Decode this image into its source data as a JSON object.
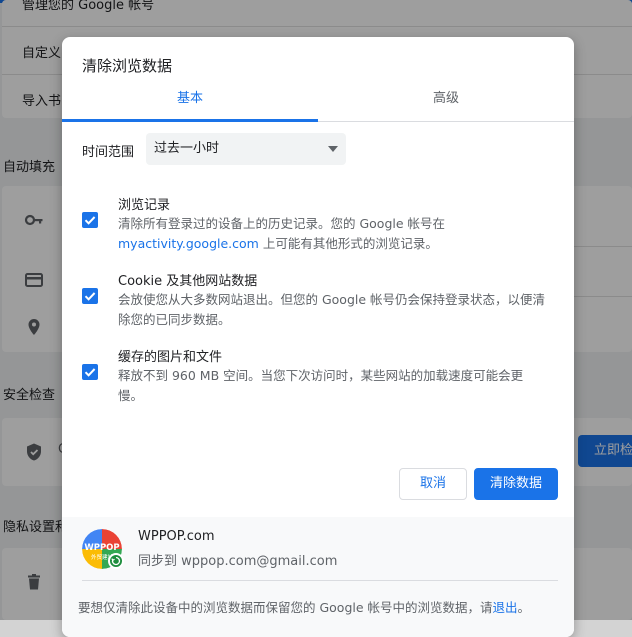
{
  "background": {
    "rows": {
      "manage_account": "管理您的 Google 帐号",
      "customize": "自定义",
      "import": "导入书"
    },
    "sections": {
      "autofill": "自动填充",
      "safety_check": "安全检查",
      "privacy": "隐私设置和"
    },
    "check_now_button": "立即检",
    "safety_text": "C"
  },
  "dialog": {
    "title": "清除浏览数据",
    "tabs": [
      {
        "label": "基本",
        "active": true
      },
      {
        "label": "高级",
        "active": false
      }
    ],
    "time_range": {
      "label": "时间范围",
      "selected": "过去一小时"
    },
    "options": [
      {
        "title": "浏览记录",
        "desc_before_link": "清除所有登录过的设备上的历史记录。您的 Google 帐号在",
        "link": "myactivity.google.com",
        "desc_after_link": " 上可能有其他形式的浏览记录。",
        "checked": true
      },
      {
        "title": "Cookie 及其他网站数据",
        "desc": "会放使您从大多数网站退出。但您的 Google 帐号仍会保持登录状态，以便清除您的已同步数据。",
        "checked": true
      },
      {
        "title": "缓存的图片和文件",
        "desc": "释放不到 960 MB 空间。当您下次访问时，某些网站的加载速度可能会更慢。",
        "checked": true
      }
    ],
    "buttons": {
      "cancel": "取消",
      "clear": "清除数据"
    },
    "account": {
      "avatar_text": "WPPOP",
      "avatar_subtext": "外贸建站",
      "name": "WPPOP.com",
      "sync": "同步到 wppop.com@gmail.com"
    },
    "footer_note": {
      "before_link": "要想仅清除此设备中的浏览数据而保留您的 Google 帐号中的浏览数据，请",
      "link": "退出",
      "after_link": "。"
    }
  },
  "colors": {
    "accent": "#1a73e8",
    "scrim": "rgba(0,0,0,0.38)",
    "sync_badge": "#1e8e3e"
  }
}
